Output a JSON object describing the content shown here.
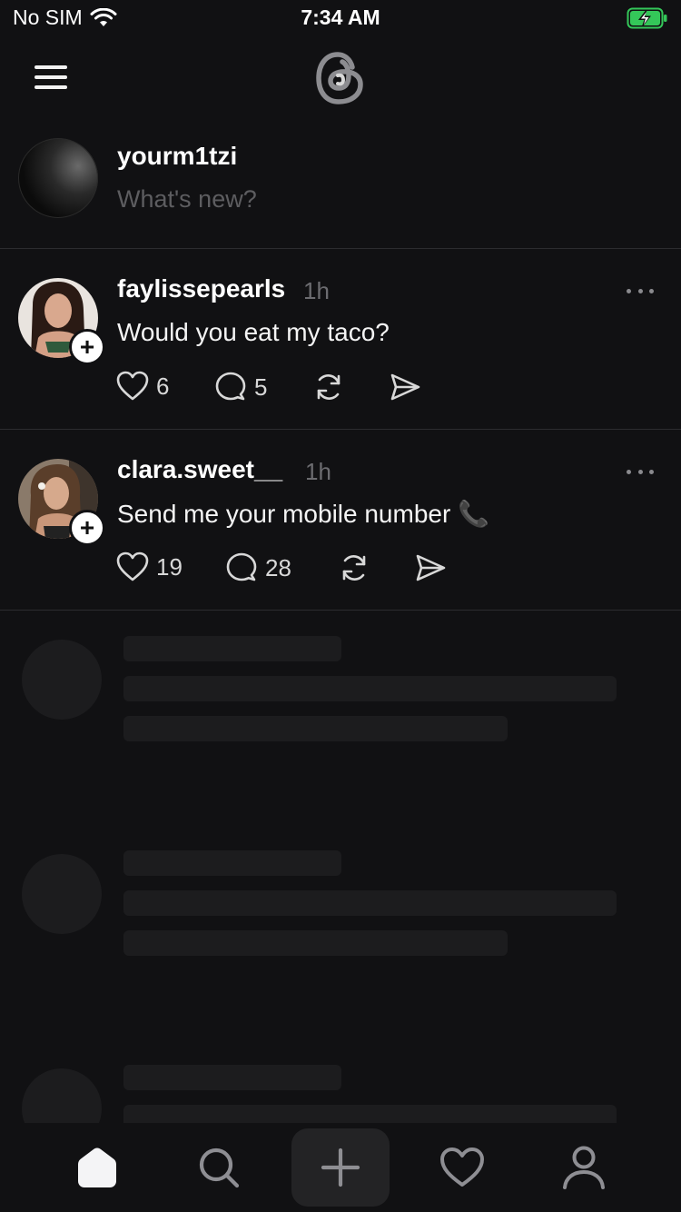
{
  "status_bar": {
    "carrier": "No SIM",
    "time": "7:34 AM",
    "wifi_icon": "wifi-icon",
    "battery_icon": "battery-charging-icon",
    "battery_color": "#34c759"
  },
  "header": {
    "menu_icon": "hamburger-menu-icon",
    "logo_icon": "threads-logo-icon"
  },
  "composer": {
    "username": "yourm1tzi",
    "placeholder": "What's new?"
  },
  "posts": [
    {
      "username": "faylissepearls",
      "time": "1h",
      "text": "Would you eat my taco?",
      "likes": "6",
      "replies": "5"
    },
    {
      "username": "clara.sweet__",
      "time": "1h",
      "text": "Send me your mobile number 📞",
      "likes": "19",
      "replies": "28"
    }
  ],
  "bottom_nav": {
    "items": [
      "home-icon",
      "search-icon",
      "plus-icon",
      "heart-icon",
      "profile-icon"
    ],
    "active": "home-icon"
  },
  "colors": {
    "background": "#111113",
    "skeleton": "#1c1c1e",
    "divider": "#2c2c2f",
    "muted_text": "#5d5d60"
  }
}
